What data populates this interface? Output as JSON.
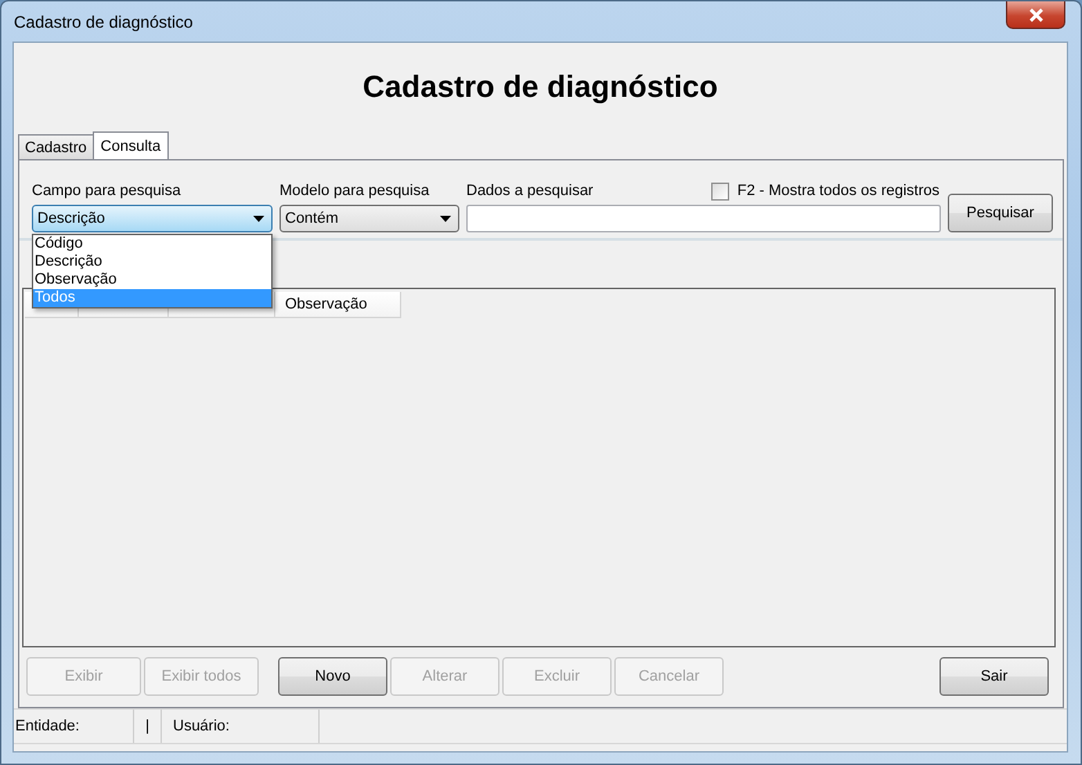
{
  "window": {
    "title": "Cadastro de diagnóstico"
  },
  "heading": "Cadastro de diagnóstico",
  "tabs": [
    {
      "label": "Cadastro",
      "selected": false
    },
    {
      "label": "Consulta",
      "selected": true
    }
  ],
  "search": {
    "field_label": "Campo para pesquisa",
    "field_value": "Descrição",
    "expanded": true,
    "field_options": [
      {
        "label": "Código",
        "selected": false
      },
      {
        "label": "Descrição",
        "selected": false
      },
      {
        "label": "Observação",
        "selected": false
      },
      {
        "label": "Todos",
        "selected": true
      }
    ],
    "mode_label": "Modelo para pesquisa",
    "mode_value": "Contém",
    "data_label": "Dados a pesquisar",
    "show_all": {
      "label": "F2 - Mostra todos os registros",
      "checked": false
    },
    "search_button": "Pesquisar"
  },
  "grid": {
    "columns": [
      {
        "kind": "blank"
      },
      {
        "kind": "blank"
      },
      {
        "kind": "blank"
      },
      {
        "kind": "text",
        "label": "Observação"
      }
    ]
  },
  "buttons": [
    {
      "label": "Exibir",
      "disabled": true
    },
    {
      "label": "Exibir todos",
      "disabled": true
    },
    {
      "label": "Novo",
      "disabled": false
    },
    {
      "label": "Alterar",
      "disabled": true
    },
    {
      "label": "Excluir",
      "disabled": true
    },
    {
      "label": "Cancelar",
      "disabled": true
    },
    {
      "label": "Sair",
      "disabled": false
    }
  ],
  "status_bar": [
    {
      "label": "Entidade:"
    },
    {
      "label": "|"
    },
    {
      "label": "Usuário:"
    }
  ]
}
